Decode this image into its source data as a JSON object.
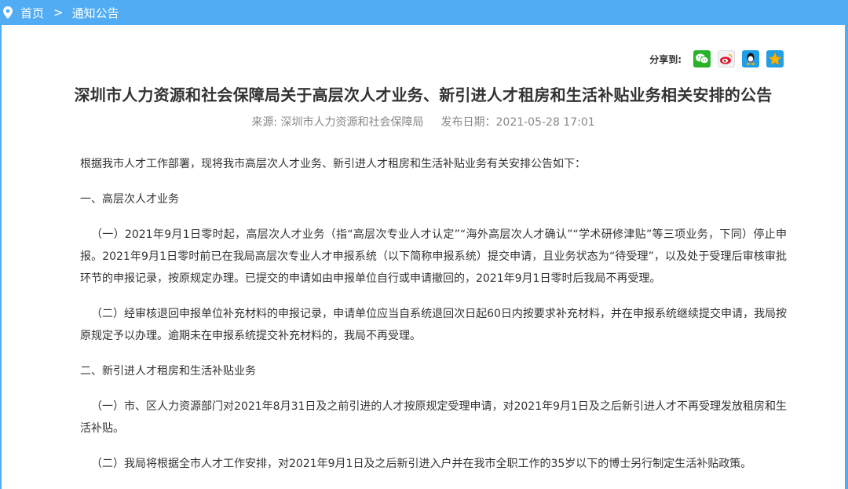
{
  "breadcrumb": {
    "home": "首页",
    "separator": ">",
    "current": "通知公告",
    "icon": "location-pin-icon"
  },
  "share": {
    "label": "分享到:",
    "buttons": [
      {
        "name": "wechat-share-icon",
        "color": "#2bb22b"
      },
      {
        "name": "weibo-share-icon",
        "color": "#e6162d"
      },
      {
        "name": "qq-share-icon",
        "color": "#1e9fe6"
      },
      {
        "name": "qzone-share-icon",
        "color": "#f6b400"
      }
    ]
  },
  "article": {
    "title": "深圳市人力资源和社会保障局关于高层次人才业务、新引进人才租房和生活补贴业务相关安排的公告",
    "source_label": "来源: ",
    "source": "深圳市人力资源和社会保障局",
    "date_label": "发布日期：",
    "date": "2021-05-28 17:01",
    "paragraphs": [
      "根据我市人才工作部署，现将我市高层次人才业务、新引进人才租房和生活补贴业务有关安排公告如下：",
      "一、高层次人才业务",
      "（一）2021年9月1日零时起，高层次人才业务（指“高层次专业人才认定”“海外高层次人才确认”“学术研修津贴”等三项业务，下同）停止申报。2021年9月1日零时前已在我局高层次专业人才申报系统（以下简称申报系统）提交申请，且业务状态为“待受理”，以及处于受理后审核审批环节的申报记录，按原规定办理。已提交的申请如由申报单位自行或申请撤回的，2021年9月1日零时后我局不再受理。",
      "（二）经审核退回申报单位补充材料的申报记录，申请单位应当自系统退回次日起60日内按要求补充材料，并在申报系统继续提交申请，我局按原规定予以办理。逾期未在申报系统提交补充材料的，我局不再受理。",
      "二、新引进人才租房和生活补贴业务",
      "（一）市、区人力资源部门对2021年8月31日及之前引进的人才按原规定受理申请，对2021年9月1日及之后新引进人才不再受理发放租房和生活补贴。",
      "（二）我局将根据全市人才工作安排，对2021年9月1日及之后新引进入户并在我市全职工作的35岁以下的博士另行制定生活补贴政策。"
    ]
  },
  "colors": {
    "header_bg": "#51acf4",
    "panel_bg": "#ffffff",
    "text": "#333333",
    "meta_text": "#888888"
  }
}
